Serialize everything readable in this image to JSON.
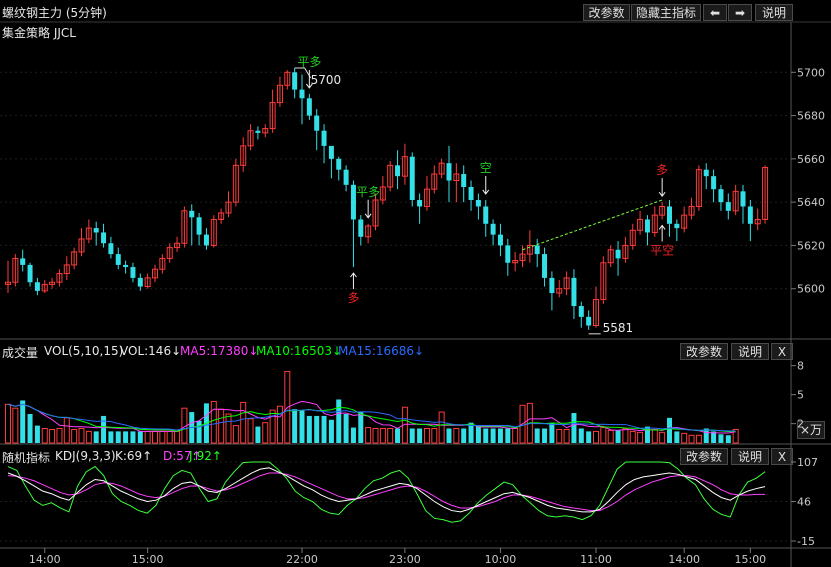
{
  "window": {
    "title": "螺纹钢主力 (5分钟)",
    "buttons": {
      "params": "改参数",
      "hide_main": "隐藏主指标",
      "left_arrow": "⬅",
      "right_arrow": "➡",
      "help": "说明"
    }
  },
  "strategy_label": "集金策略 JJCL",
  "price_axis": {
    "ticks": [
      "5700",
      "5680",
      "5660",
      "5640",
      "5620",
      "5600"
    ]
  },
  "annotations": {
    "high_label": "5700",
    "low_label": "5581",
    "signals": [
      {
        "text": "平多",
        "color": "#22cc22"
      },
      {
        "text": "平多",
        "color": "#22cc22"
      },
      {
        "text": "多",
        "color": "#ee2222"
      },
      {
        "text": "空",
        "color": "#22cc22"
      },
      {
        "text": "多",
        "color": "#ee2222"
      },
      {
        "text": "平空",
        "color": "#ee2222"
      }
    ]
  },
  "volume_panel": {
    "label_name": "成交量",
    "label_params": "VOL(5,10,15)",
    "vol": "VOL:146↓",
    "ma5": "MA5:17380↓",
    "ma10": "MA10:16503↓",
    "ma15": "MA15:16686↓",
    "ticks": [
      "8",
      "5",
      "2"
    ],
    "unit": "×万",
    "btn_params": "改参数",
    "btn_help": "说明",
    "btn_close": "X"
  },
  "kdj_panel": {
    "label_name": "随机指标",
    "label_params": "KDJ(9,3,3)",
    "k": "K:69↑",
    "d": "D:57↑",
    "j": "J:92↑",
    "ticks": [
      "107",
      "46",
      "-15"
    ],
    "btn_params": "改参数",
    "btn_help": "说明",
    "btn_close": "X"
  },
  "time_axis": {
    "labels": [
      "14:00",
      "15:00",
      "22:00",
      "23:00",
      "10:00",
      "11:00",
      "14:00",
      "15:00"
    ]
  },
  "colors": {
    "up": "#ff3b3b",
    "down": "#34e0e8",
    "ma5": "#ff40ff",
    "ma10": "#00ff00",
    "ma15": "#2a6bff"
  },
  "chart_data": {
    "type": "candlestick",
    "ylim": [
      5581,
      5710
    ],
    "candles": [
      [
        5602,
        5603,
        5598,
        5613
      ],
      [
        5603,
        5614,
        5601,
        5616
      ],
      [
        5614,
        5611,
        5608,
        5618
      ],
      [
        5611,
        5603,
        5601,
        5612
      ],
      [
        5603,
        5599,
        5597,
        5605
      ],
      [
        5599,
        5602,
        5598,
        5604
      ],
      [
        5602,
        5603,
        5600,
        5605
      ],
      [
        5603,
        5607,
        5601,
        5609
      ],
      [
        5607,
        5611,
        5604,
        5615
      ],
      [
        5611,
        5617,
        5609,
        5619
      ],
      [
        5617,
        5623,
        5615,
        5628
      ],
      [
        5623,
        5628,
        5621,
        5632
      ],
      [
        5628,
        5626,
        5620,
        5631
      ],
      [
        5626,
        5621,
        5619,
        5630
      ],
      [
        5621,
        5616,
        5614,
        5624
      ],
      [
        5616,
        5611,
        5609,
        5619
      ],
      [
        5611,
        5610,
        5607,
        5613
      ],
      [
        5610,
        5605,
        5603,
        5612
      ],
      [
        5605,
        5601,
        5599,
        5607
      ],
      [
        5601,
        5605,
        5600,
        5607
      ],
      [
        5605,
        5609,
        5603,
        5611
      ],
      [
        5609,
        5614,
        5607,
        5616
      ],
      [
        5614,
        5619,
        5612,
        5621
      ],
      [
        5619,
        5621,
        5617,
        5624
      ],
      [
        5621,
        5636,
        5619,
        5638
      ],
      [
        5636,
        5633,
        5620,
        5639
      ],
      [
        5633,
        5625,
        5620,
        5635
      ],
      [
        5625,
        5620,
        5618,
        5628
      ],
      [
        5620,
        5632,
        5619,
        5634
      ],
      [
        5632,
        5635,
        5630,
        5637
      ],
      [
        5635,
        5640,
        5633,
        5645
      ],
      [
        5640,
        5657,
        5638,
        5660
      ],
      [
        5657,
        5666,
        5654,
        5670
      ],
      [
        5666,
        5673,
        5664,
        5676
      ],
      [
        5673,
        5672,
        5669,
        5675
      ],
      [
        5672,
        5674,
        5670,
        5676
      ],
      [
        5674,
        5686,
        5672,
        5692
      ],
      [
        5686,
        5694,
        5684,
        5698
      ],
      [
        5694,
        5700,
        5692,
        5701
      ],
      [
        5700,
        5692,
        5688,
        5702
      ],
      [
        5692,
        5688,
        5676,
        5699
      ],
      [
        5688,
        5680,
        5678,
        5690
      ],
      [
        5680,
        5673,
        5664,
        5683
      ],
      [
        5673,
        5666,
        5658,
        5676
      ],
      [
        5666,
        5660,
        5651,
        5663
      ],
      [
        5660,
        5655,
        5650,
        5661
      ],
      [
        5655,
        5648,
        5645,
        5657
      ],
      [
        5648,
        5632,
        5610,
        5650
      ],
      [
        5632,
        5624,
        5620,
        5634
      ],
      [
        5624,
        5629,
        5621,
        5630
      ],
      [
        5629,
        5641,
        5627,
        5644
      ],
      [
        5641,
        5647,
        5639,
        5652
      ],
      [
        5647,
        5657,
        5645,
        5659
      ],
      [
        5657,
        5652,
        5646,
        5664
      ],
      [
        5652,
        5661,
        5648,
        5667
      ],
      [
        5661,
        5641,
        5638,
        5663
      ],
      [
        5641,
        5638,
        5630,
        5644
      ],
      [
        5638,
        5646,
        5636,
        5652
      ],
      [
        5646,
        5653,
        5644,
        5657
      ],
      [
        5653,
        5658,
        5651,
        5660
      ],
      [
        5658,
        5650,
        5640,
        5666
      ],
      [
        5650,
        5653,
        5640,
        5658
      ],
      [
        5653,
        5647,
        5640,
        5657
      ],
      [
        5647,
        5641,
        5636,
        5650
      ],
      [
        5641,
        5638,
        5632,
        5644
      ],
      [
        5638,
        5630,
        5624,
        5641
      ],
      [
        5630,
        5625,
        5620,
        5632
      ],
      [
        5625,
        5620,
        5615,
        5630
      ],
      [
        5620,
        5612,
        5606,
        5623
      ],
      [
        5612,
        5613,
        5608,
        5617
      ],
      [
        5613,
        5616,
        5610,
        5620
      ],
      [
        5616,
        5620,
        5612,
        5627
      ],
      [
        5620,
        5616,
        5610,
        5623
      ],
      [
        5616,
        5605,
        5601,
        5619
      ],
      [
        5605,
        5598,
        5590,
        5608
      ],
      [
        5598,
        5600,
        5596,
        5604
      ],
      [
        5600,
        5605,
        5597,
        5608
      ],
      [
        5605,
        5592,
        5586,
        5609
      ],
      [
        5592,
        5587,
        5582,
        5594
      ],
      [
        5587,
        5583,
        5581,
        5590
      ],
      [
        5583,
        5595,
        5582,
        5601
      ],
      [
        5595,
        5612,
        5593,
        5615
      ],
      [
        5612,
        5618,
        5610,
        5620
      ],
      [
        5618,
        5614,
        5606,
        5622
      ],
      [
        5614,
        5620,
        5612,
        5624
      ],
      [
        5620,
        5627,
        5618,
        5630
      ],
      [
        5627,
        5632,
        5625,
        5636
      ],
      [
        5632,
        5626,
        5620,
        5634
      ],
      [
        5626,
        5634,
        5624,
        5638
      ],
      [
        5634,
        5638,
        5632,
        5640
      ],
      [
        5638,
        5630,
        5624,
        5641
      ],
      [
        5630,
        5628,
        5622,
        5632
      ],
      [
        5628,
        5634,
        5626,
        5638
      ],
      [
        5634,
        5638,
        5632,
        5642
      ],
      [
        5638,
        5655,
        5636,
        5657
      ],
      [
        5655,
        5652,
        5646,
        5658
      ],
      [
        5652,
        5646,
        5640,
        5655
      ],
      [
        5646,
        5640,
        5636,
        5648
      ],
      [
        5640,
        5636,
        5632,
        5644
      ],
      [
        5636,
        5645,
        5634,
        5648
      ],
      [
        5645,
        5638,
        5630,
        5648
      ],
      [
        5638,
        5630,
        5622,
        5641
      ],
      [
        5630,
        5632,
        5627,
        5637
      ],
      [
        5632,
        5656,
        5630,
        5657
      ]
    ],
    "volume": [
      4.0,
      3.6,
      4.4,
      3.0,
      1.8,
      1.5,
      1.4,
      1.5,
      2.6,
      1.4,
      1.5,
      1.2,
      1.2,
      2.8,
      1.2,
      1.2,
      1.2,
      1.2,
      1.2,
      1.2,
      1.2,
      1.2,
      1.2,
      1.2,
      3.6,
      3.2,
      2.3,
      4.1,
      4.3,
      3.5,
      3.0,
      1.8,
      4.2,
      2.5,
      1.7,
      2.1,
      3.4,
      3.8,
      7.4,
      3.5,
      3.4,
      2.8,
      2.8,
      2.8,
      2.4,
      4.5,
      3.0,
      1.6,
      3.2,
      1.6,
      1.5,
      1.5,
      1.5,
      1.5,
      3.7,
      1.5,
      1.5,
      1.5,
      1.5,
      3.2,
      1.5,
      1.5,
      1.5,
      2.1,
      1.7,
      1.5,
      1.5,
      1.5,
      1.5,
      1.5,
      3.9,
      4.1,
      1.5,
      1.5,
      2.1,
      1.4,
      1.4,
      3.1,
      1.5,
      1.2,
      1.2,
      1.6,
      1.3,
      1.3,
      1.5,
      1.2,
      1.1,
      1.7,
      1.4,
      1.1,
      2.6,
      1.2,
      1.0,
      0.8,
      0.8,
      1.5,
      1.2,
      0.9,
      0.8,
      1.4
    ],
    "kdj_k": [
      90,
      85,
      78,
      70,
      62,
      58,
      52,
      48,
      60,
      72,
      80,
      78,
      70,
      62,
      56,
      50,
      46,
      48,
      55,
      66,
      74,
      76,
      70,
      62,
      60,
      66,
      74,
      82,
      90,
      96,
      98,
      92,
      86,
      78,
      70,
      64,
      56,
      50,
      46,
      48,
      50,
      56,
      62,
      66,
      70,
      74,
      72,
      66,
      56,
      46,
      38,
      32,
      30,
      34,
      40,
      46,
      52,
      58,
      60,
      56,
      52,
      46,
      40,
      36,
      34,
      32,
      30,
      30,
      34,
      46,
      60,
      72,
      80,
      84,
      86,
      88,
      90,
      88,
      84,
      80,
      70,
      60,
      52,
      48,
      56,
      62,
      66,
      69
    ],
    "kdj_d": [
      86,
      85,
      82,
      78,
      72,
      66,
      60,
      56,
      58,
      64,
      72,
      75,
      74,
      70,
      64,
      58,
      54,
      52,
      54,
      60,
      66,
      70,
      70,
      66,
      62,
      64,
      68,
      74,
      80,
      86,
      90,
      90,
      88,
      84,
      78,
      72,
      66,
      60,
      54,
      50,
      50,
      52,
      56,
      60,
      64,
      68,
      70,
      68,
      62,
      54,
      46,
      40,
      36,
      36,
      38,
      42,
      46,
      52,
      56,
      56,
      54,
      50,
      46,
      42,
      38,
      36,
      34,
      32,
      32,
      38,
      46,
      56,
      64,
      70,
      76,
      80,
      84,
      86,
      86,
      84,
      78,
      72,
      64,
      58,
      56,
      56,
      57,
      57
    ],
    "kdj_j": [
      100,
      94,
      70,
      48,
      40,
      44,
      36,
      30,
      70,
      92,
      100,
      86,
      58,
      46,
      40,
      32,
      28,
      40,
      66,
      86,
      94,
      90,
      66,
      46,
      50,
      76,
      92,
      106,
      107,
      107,
      107,
      96,
      82,
      62,
      52,
      46,
      34,
      28,
      26,
      40,
      50,
      66,
      78,
      82,
      90,
      94,
      82,
      58,
      32,
      20,
      18,
      14,
      16,
      28,
      44,
      56,
      66,
      76,
      72,
      56,
      44,
      32,
      24,
      22,
      24,
      22,
      18,
      24,
      40,
      68,
      96,
      107,
      107,
      107,
      107,
      107,
      106,
      96,
      82,
      72,
      50,
      34,
      26,
      22,
      56,
      76,
      82,
      92
    ]
  }
}
